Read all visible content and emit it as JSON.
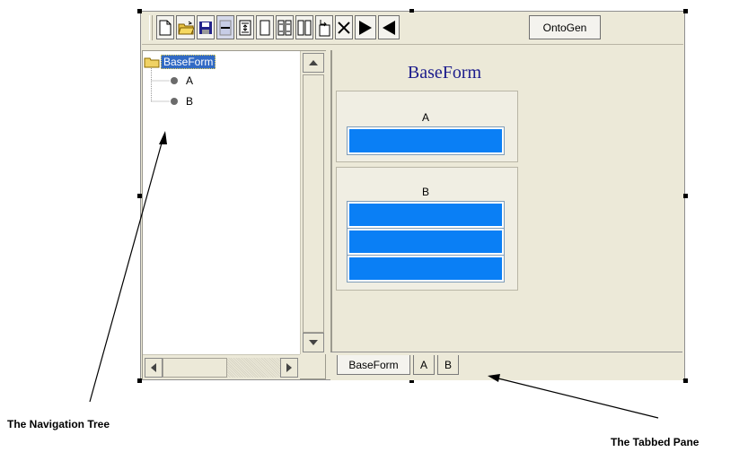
{
  "toolbar": {
    "icons": [
      "new-file-icon",
      "open-folder-icon",
      "save-icon",
      "minus-icon",
      "insert-row-icon",
      "blank-page-icon",
      "insert-multiple-icon",
      "columns-icon",
      "insert-before-icon",
      "delete-icon",
      "play-right-icon",
      "play-left-icon"
    ],
    "ontogen_label": "OntoGen"
  },
  "tree": {
    "root": "BaseForm",
    "children": [
      "A",
      "B"
    ]
  },
  "form": {
    "title": "BaseForm",
    "groups": [
      {
        "label": "A",
        "field_count": 1
      },
      {
        "label": "B",
        "field_count": 3
      }
    ],
    "field_color": "#0a7ff5"
  },
  "tabs": [
    {
      "label": "BaseForm",
      "active": true
    },
    {
      "label": "A",
      "active": false
    },
    {
      "label": "B",
      "active": false
    }
  ],
  "annotations": {
    "navigation_tree": "The Navigation Tree",
    "tabbed_pane": "The Tabbed Pane"
  }
}
